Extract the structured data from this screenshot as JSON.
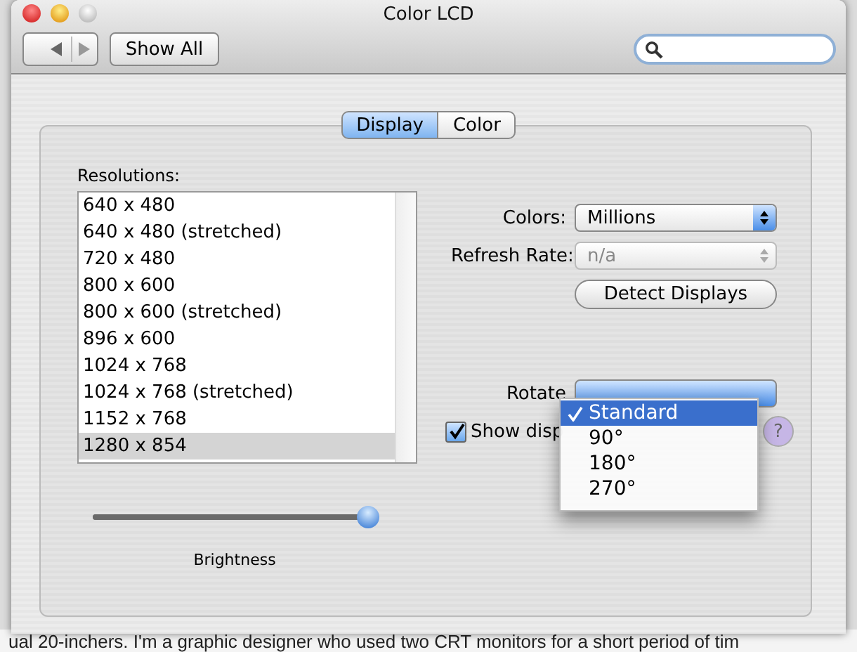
{
  "window": {
    "title": "Color LCD"
  },
  "toolbar": {
    "show_all": "Show All"
  },
  "tabs": [
    {
      "label": "Display",
      "selected": true
    },
    {
      "label": "Color",
      "selected": false
    }
  ],
  "resolutions": {
    "label": "Resolutions:",
    "items": [
      {
        "label": "640 x 480",
        "selected": false
      },
      {
        "label": "640 x 480 (stretched)",
        "selected": false
      },
      {
        "label": "720 x 480",
        "selected": false
      },
      {
        "label": "800 x 600",
        "selected": false
      },
      {
        "label": "800 x 600 (stretched)",
        "selected": false
      },
      {
        "label": "896 x 600",
        "selected": false
      },
      {
        "label": "1024 x 768",
        "selected": false
      },
      {
        "label": "1024 x 768 (stretched)",
        "selected": false
      },
      {
        "label": "1152 x 768",
        "selected": false
      },
      {
        "label": "1280 x 854",
        "selected": true
      }
    ]
  },
  "colors": {
    "label": "Colors:",
    "value": "Millions",
    "disabled": false
  },
  "refresh_rate": {
    "label": "Refresh Rate:",
    "value": "n/a",
    "disabled": true
  },
  "detect_button": "Detect Displays",
  "rotate": {
    "label": "Rotate",
    "menu": [
      {
        "label": "Standard",
        "selected": true
      },
      {
        "label": "90°",
        "selected": false
      },
      {
        "label": "180°",
        "selected": false
      },
      {
        "label": "270°",
        "selected": false
      }
    ]
  },
  "show_displays": {
    "label": "Show disp",
    "checked": true
  },
  "help": "?",
  "brightness": {
    "label": "Brightness",
    "level": 0.97
  },
  "background_text": "ual 20-inchers. I'm a graphic designer who used two CRT monitors for a short period of tim"
}
